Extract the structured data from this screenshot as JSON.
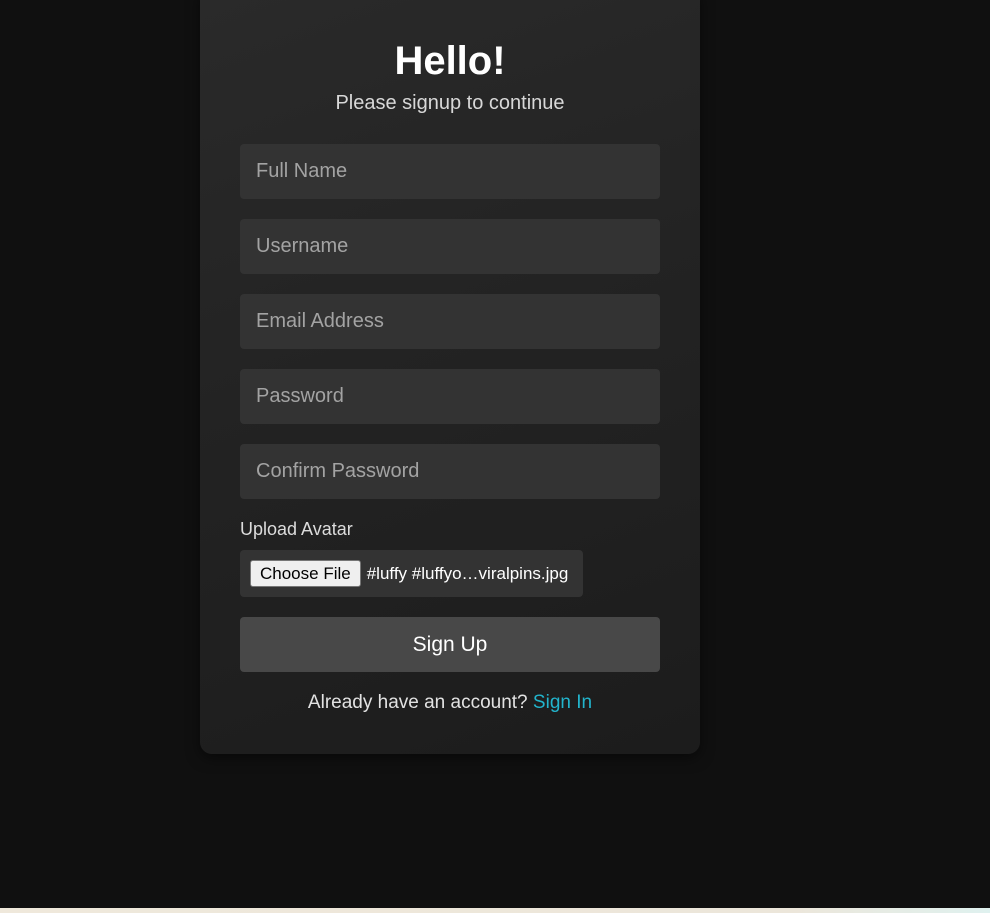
{
  "form": {
    "title": "Hello!",
    "subtitle": "Please signup to continue",
    "fields": {
      "full_name": {
        "placeholder": "Full Name",
        "value": ""
      },
      "username": {
        "placeholder": "Username",
        "value": ""
      },
      "email": {
        "placeholder": "Email Address",
        "value": ""
      },
      "password": {
        "placeholder": "Password",
        "value": ""
      },
      "confirm_password": {
        "placeholder": "Confirm Password",
        "value": ""
      }
    },
    "avatar": {
      "label": "Upload Avatar",
      "button_label": "Choose File",
      "file_name": "#luffy #luffyo…viralpins.jpg"
    },
    "submit_label": "Sign Up",
    "footer": {
      "prompt": "Already have an account?",
      "link_label": "Sign In"
    }
  },
  "colors": {
    "page_background": "#101010",
    "card_background": "#262626",
    "input_background": "#333333",
    "button_background": "#484848",
    "link": "#22b4cc"
  }
}
